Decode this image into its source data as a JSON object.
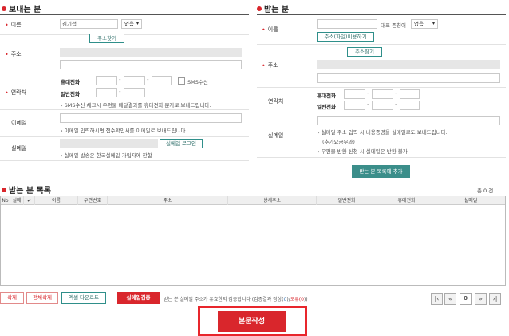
{
  "sender": {
    "title": "보내는 분",
    "name_label": "이름",
    "name_value": "김기섭",
    "honorific_value": "없음",
    "address_label": "주소",
    "address_search_button": "주소찾기",
    "contact_label": "연락처",
    "mobile_label": "휴대전화",
    "landline_label": "일반전화",
    "sms_label": "SMS수신",
    "sms_note": "SMS수신 체크시 우편물 배달결과를 휴대전화 문자로 보내드립니다.",
    "email_label": "이메일",
    "email_note": "이메일 입력하시면 접수확인서를 이메일로 보내드립니다.",
    "sealmail_label": "실메일",
    "sealmail_login_button": "실메일 로그인",
    "sealmail_note": "실메일 발송은 한국실메일 가입자에 한함"
  },
  "receiver": {
    "title": "받는 분",
    "name_label": "이름",
    "honorific_label": "대표 존칭어",
    "honorific_value": "없음",
    "address_file_button": "주소(파일)이용하기",
    "address_label": "주소",
    "address_search_button": "주소찾기",
    "contact_label": "연락처",
    "mobile_label": "휴대전화",
    "landline_label": "일반전화",
    "sealmail_label": "실메일",
    "sealmail_note1": "실메일 주소 입력 시 내용증명을 실메일로도 보내드립니다.",
    "sealmail_note2": "(추가요금부과)",
    "sealmail_note3": "우편물 반환 신청 시 실메일은 반환 불가",
    "add_button": "받는 분 목록에 추가"
  },
  "list": {
    "title": "받는 분 목록",
    "total": "총 0 건",
    "columns": [
      "No",
      "실메",
      "",
      "이름",
      "우편번호",
      "주소",
      "상세주소",
      "일반전화",
      "휴대전화",
      "실메일"
    ]
  },
  "bottom": {
    "delete_button": "삭제",
    "delete_all_button": "전체삭제",
    "excel_button": "엑셀 다운로드",
    "verify_button": "실메일검증",
    "verify_note_prefix": "받는 분 실메일 주소가 유효한지 검증합니다 (",
    "verify_note_success": "검증결과 정상(",
    "verify_note_success_count": "0",
    "verify_note_mid": ")/",
    "verify_note_error": "오류(",
    "verify_note_error_count": "0",
    "verify_note_suffix": "))",
    "page_number": "0",
    "write_button": "본문작성"
  }
}
